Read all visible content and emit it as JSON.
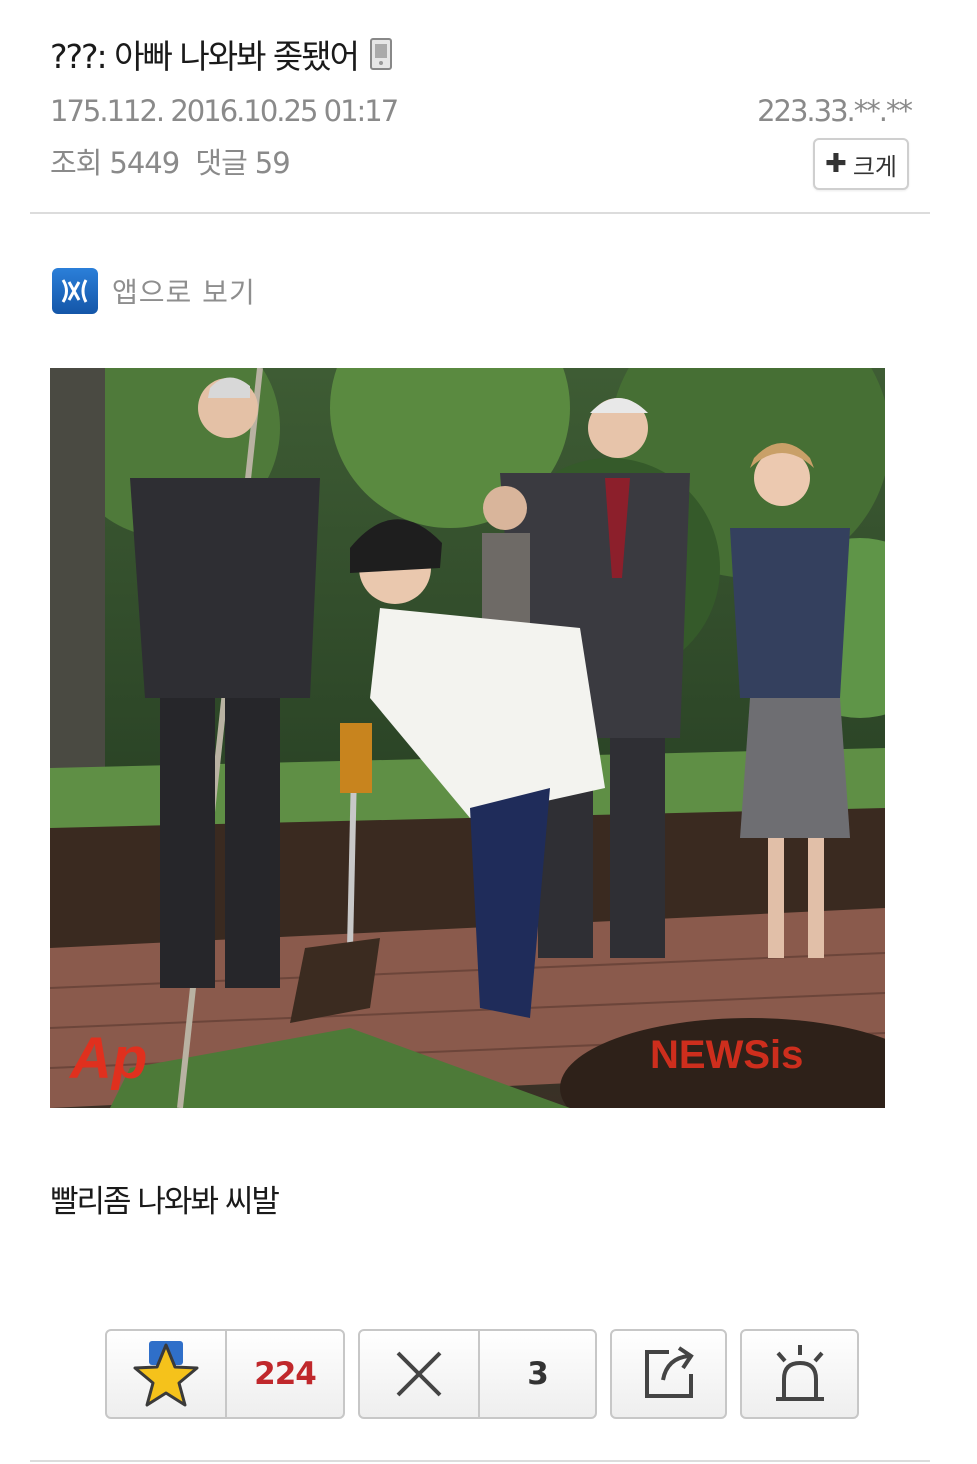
{
  "post": {
    "title": "???: 아빠 나와봐 좆됐어",
    "author_ip": "175.112.",
    "datetime": "2016.10.25 01:17",
    "views_label": "조회",
    "views": "5449",
    "comments_label": "댓글",
    "comments": "59",
    "right_ip": "223.33.**.**",
    "body_text": "빨리좀 나와봐 씨발"
  },
  "toolbar": {
    "size_label": "크게"
  },
  "app": {
    "label": "앱으로 보기"
  },
  "photo": {
    "watermark_left": "Ap",
    "watermark_right": "NEWSis"
  },
  "actions": {
    "recommend_count": "224",
    "oppose_count": "3"
  },
  "colors": {
    "recommend_count": "#c0282c",
    "app_icon": "#1f6cc4",
    "meta_text": "#8a8a8a"
  }
}
